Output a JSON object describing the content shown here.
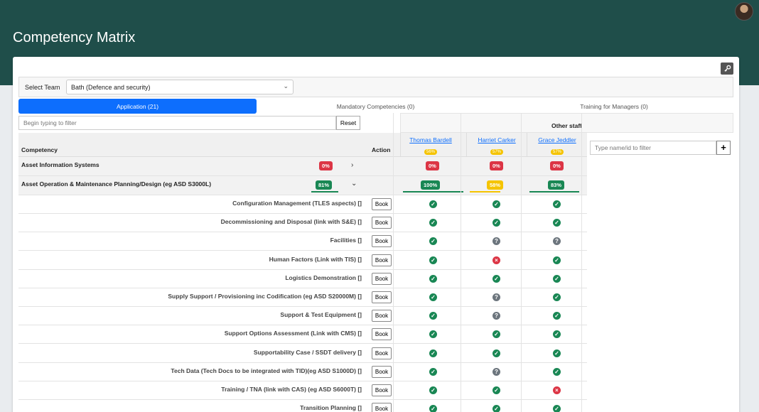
{
  "app": {
    "title": "Competency Matrix"
  },
  "team": {
    "label": "Select Team",
    "value": "Bath (Defence and security)"
  },
  "tabs": [
    {
      "label": "Application (21)",
      "active": true
    },
    {
      "label": "Mandatory Competencies (0)",
      "active": false
    },
    {
      "label": "Training for Managers (0)",
      "active": false
    }
  ],
  "filter": {
    "placeholder": "Begin typing to filter",
    "reset_label": "Reset"
  },
  "other_staff_label": "Other staff",
  "name_filter": {
    "placeholder": "Type name/id to filter"
  },
  "add_label": "+",
  "columns": {
    "competency": "Competency",
    "action": "Action"
  },
  "staff": [
    {
      "name": "Thomas Bardell",
      "pct": "56%"
    },
    {
      "name": "Harriet Carker",
      "pct": "57%"
    },
    {
      "name": "Grace Jeddler",
      "pct": "57%"
    }
  ],
  "categories": [
    {
      "name": "Asset Information Systems",
      "pct": "0%",
      "pct_color": "red",
      "staff_pcts": [
        "0%",
        "0%",
        "0%"
      ],
      "staff_colors": [
        "red",
        "red",
        "red"
      ],
      "expanded": false
    },
    {
      "name": "Asset Operation & Maintenance Planning/Design (eg ASD S3000L)",
      "pct": "81%",
      "pct_color": "green",
      "progress": 0.81,
      "staff_pcts": [
        "100%",
        "58%",
        "83%"
      ],
      "staff_colors": [
        "green",
        "yellow",
        "green"
      ],
      "staff_progress": [
        1.0,
        0.58,
        0.83
      ],
      "expanded": true
    }
  ],
  "book_label": "Book",
  "items": [
    {
      "label": "Configuration Management (TLES aspects) []",
      "status": [
        "ok",
        "ok",
        "ok"
      ]
    },
    {
      "label": "Decommissioning and Disposal (link with S&E) []",
      "status": [
        "ok",
        "ok",
        "ok"
      ]
    },
    {
      "label": "Facilities []",
      "status": [
        "ok",
        "unknown",
        "unknown"
      ]
    },
    {
      "label": "Human Factors (Link with TIS) []",
      "status": [
        "ok",
        "fail",
        "ok"
      ]
    },
    {
      "label": "Logistics Demonstration []",
      "status": [
        "ok",
        "ok",
        "ok"
      ]
    },
    {
      "label": "Supply Support / Provisioning inc Codification (eg ASD S20000M) []",
      "status": [
        "ok",
        "unknown",
        "ok"
      ]
    },
    {
      "label": "Support & Test Equipment []",
      "status": [
        "ok",
        "unknown",
        "ok"
      ]
    },
    {
      "label": "Support Options Assessment (Link with CMS) []",
      "status": [
        "ok",
        "ok",
        "ok"
      ]
    },
    {
      "label": "Supportability Case / SSDT delivery []",
      "status": [
        "ok",
        "ok",
        "ok"
      ]
    },
    {
      "label": "Tech Data (Tech Docs to be integrated with TID)(eg ASD S1000D) []",
      "status": [
        "ok",
        "unknown",
        "ok"
      ]
    },
    {
      "label": "Training / TNA (link with CAS) (eg ASD S6000T) []",
      "status": [
        "ok",
        "ok",
        "fail"
      ]
    },
    {
      "label": "Transition Planning []",
      "status": [
        "ok",
        "ok",
        "ok"
      ]
    }
  ],
  "colors": {
    "banner": "#1f4e4a",
    "accent": "#0d6efd",
    "green": "#198754",
    "red": "#dc3545",
    "yellow": "#f5c400",
    "grey": "#6c757d"
  }
}
